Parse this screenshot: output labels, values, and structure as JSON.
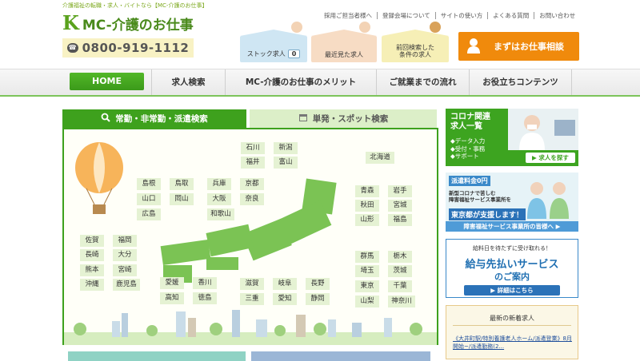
{
  "header": {
    "tagline": "介護福祉の転職・求人・バイトなら【MC-介護のお仕事】",
    "logo_mark": "K",
    "logo_text": "MC-介護のお仕事",
    "phone_icon": "☎",
    "phone": "0800-919-1112",
    "top_links": [
      "採用ご担当者様へ",
      "登録会場について",
      "サイトの使い方",
      "よくある質問",
      "お問い合わせ"
    ],
    "stock_label": "ストック求人",
    "stock_count": "0",
    "recent_label": "最近見た求人",
    "prev_search_label_1": "前回検索した",
    "prev_search_label_2": "条件の求人",
    "consult_label": "まずはお仕事相談"
  },
  "nav": {
    "items": [
      "HOME",
      "求人検索",
      "MC-介護のお仕事のメリット",
      "ご就業までの流れ",
      "お役立ちコンテンツ"
    ]
  },
  "search": {
    "tab_regular": "常勤・非常勤・派遣検索",
    "tab_spot": "単発・スポット検索",
    "prefectures": {
      "hokuriku": [
        "石川",
        "新潟",
        "福井",
        "富山"
      ],
      "hokkaido": "北海道",
      "chugoku": [
        "島根",
        "鳥取",
        "山口",
        "岡山",
        "広島"
      ],
      "kinki": [
        "兵庫",
        "京都",
        "大阪",
        "奈良",
        "和歌山"
      ],
      "tohoku": [
        "青森",
        "岩手",
        "秋田",
        "宮城",
        "山形",
        "福島"
      ],
      "kyushu": [
        "佐賀",
        "福岡",
        "長崎",
        "大分",
        "熊本",
        "宮崎",
        "沖縄",
        "鹿児島"
      ],
      "shikoku": [
        "愛媛",
        "香川",
        "高知",
        "徳島"
      ],
      "tokai": [
        "滋賀",
        "岐阜",
        "長野",
        "三重",
        "愛知",
        "静岡"
      ],
      "kanto": [
        "群馬",
        "栃木",
        "埼玉",
        "茨城",
        "東京",
        "千葉",
        "山梨",
        "神奈川"
      ]
    }
  },
  "sidebar": {
    "corona_title_1": "コロナ関連",
    "corona_title_2": "求人一覧",
    "corona_items": [
      "◆データ入力",
      "◆受付・事務",
      "◆サポート"
    ],
    "corona_button": "▶ 求人を探す",
    "dispatch_price": "派遣料金0円",
    "dispatch_sub_1": "新型コロナで苦しむ",
    "dispatch_sub_2": "障害福祉サービス事業所を",
    "dispatch_support": "東京都が支援します！",
    "dispatch_footer": "障害福祉サービス事業所の皆様へ ▶",
    "salary_top": "給料日を待たずに受け取れる！",
    "salary_main": "給与先払いサービス",
    "salary_sub": "のご案内",
    "salary_button": "▶ 詳細はこちら",
    "newjobs_title": "最新の新着求人",
    "newjobs_text": "《大井町駅/特別養護老人ホーム/派遣登業》8月開始~/派遣勤務(2..."
  },
  "colors": {
    "brand_green": "#3ea11d",
    "accent_orange": "#f08a0c",
    "blue": "#2b72b8"
  }
}
